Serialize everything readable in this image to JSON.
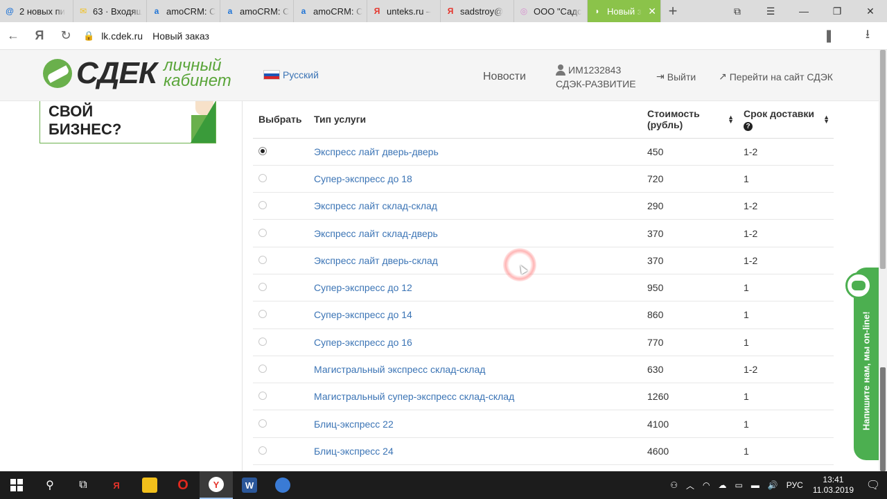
{
  "browser": {
    "tabs": [
      {
        "title": "2 новых пи",
        "icon": "mail-icon",
        "icon_color": "#1e73d6",
        "icon_glyph": "@"
      },
      {
        "title": "63 · Входящ",
        "icon": "yandex-mail-icon",
        "icon_color": "#f2c01b",
        "icon_glyph": "✉"
      },
      {
        "title": "amoCRM: С",
        "icon": "amocrm-icon",
        "icon_color": "#1e73d6",
        "icon_glyph": "a"
      },
      {
        "title": "amoCRM: С",
        "icon": "amocrm-icon",
        "icon_color": "#1e73d6",
        "icon_glyph": "a"
      },
      {
        "title": "amoCRM: С",
        "icon": "amocrm-icon",
        "icon_color": "#1e73d6",
        "icon_glyph": "a"
      },
      {
        "title": "unteks.ru –",
        "icon": "yandex-icon",
        "icon_color": "#e5332a",
        "icon_glyph": "Я"
      },
      {
        "title": "sadstroy@",
        "icon": "yandex-icon",
        "icon_color": "#e5332a",
        "icon_glyph": "Я"
      },
      {
        "title": "ООО \"Садс",
        "icon": "site-icon",
        "icon_color": "#d78fd0",
        "icon_glyph": "◎"
      },
      {
        "title": "Новый з",
        "icon": "cdek-icon",
        "icon_color": "#ffffff",
        "icon_glyph": "◗",
        "active": true
      }
    ],
    "address": {
      "domain": "lk.cdek.ru",
      "page_title": "Новый заказ"
    }
  },
  "header": {
    "logo_text": "СДЕК",
    "logo_sub_line1": "личный",
    "logo_sub_line2": "кабинет",
    "language": "Русский",
    "news": "Новости",
    "user_id": "ИМ1232843",
    "user_company": "СДЭК-РАЗВИТИЕ",
    "logout": "Выйти",
    "goto_site": "Перейти на сайт СДЭК"
  },
  "banner": {
    "line1": "СВОЙ",
    "line2": "БИЗНЕС?"
  },
  "table": {
    "headers": {
      "select": "Выбрать",
      "service": "Тип услуги",
      "cost_line1": "Стоимость",
      "cost_line2": "(рубль)",
      "term": "Срок доставки"
    },
    "rows": [
      {
        "service": "Экспресс лайт дверь-дверь",
        "cost": "450",
        "term": "1-2",
        "selected": true
      },
      {
        "service": "Супер-экспресс до 18",
        "cost": "720",
        "term": "1",
        "selected": false
      },
      {
        "service": "Экспресс лайт склад-склад",
        "cost": "290",
        "term": "1-2",
        "selected": false
      },
      {
        "service": "Экспресс лайт склад-дверь",
        "cost": "370",
        "term": "1-2",
        "selected": false
      },
      {
        "service": "Экспресс лайт дверь-склад",
        "cost": "370",
        "term": "1-2",
        "selected": false
      },
      {
        "service": "Супер-экспресс до 12",
        "cost": "950",
        "term": "1",
        "selected": false
      },
      {
        "service": "Супер-экспресс до 14",
        "cost": "860",
        "term": "1",
        "selected": false
      },
      {
        "service": "Супер-экспресс до 16",
        "cost": "770",
        "term": "1",
        "selected": false
      },
      {
        "service": "Магистральный экспресс склад-склад",
        "cost": "630",
        "term": "1-2",
        "selected": false
      },
      {
        "service": "Магистральный супер-экспресс склад-склад",
        "cost": "1260",
        "term": "1",
        "selected": false
      },
      {
        "service": "Блиц-экспресс 22",
        "cost": "4100",
        "term": "1",
        "selected": false
      },
      {
        "service": "Блиц-экспресс 24",
        "cost": "4600",
        "term": "1",
        "selected": false
      }
    ]
  },
  "chat": {
    "label": "Напишите нам, мы on-line!"
  },
  "taskbar": {
    "language": "РУС",
    "time": "13:41",
    "date": "11.03.2019"
  },
  "colors": {
    "brand_green": "#6ab04c",
    "link_blue": "#3b74b5",
    "chat_green": "#4caf50"
  }
}
